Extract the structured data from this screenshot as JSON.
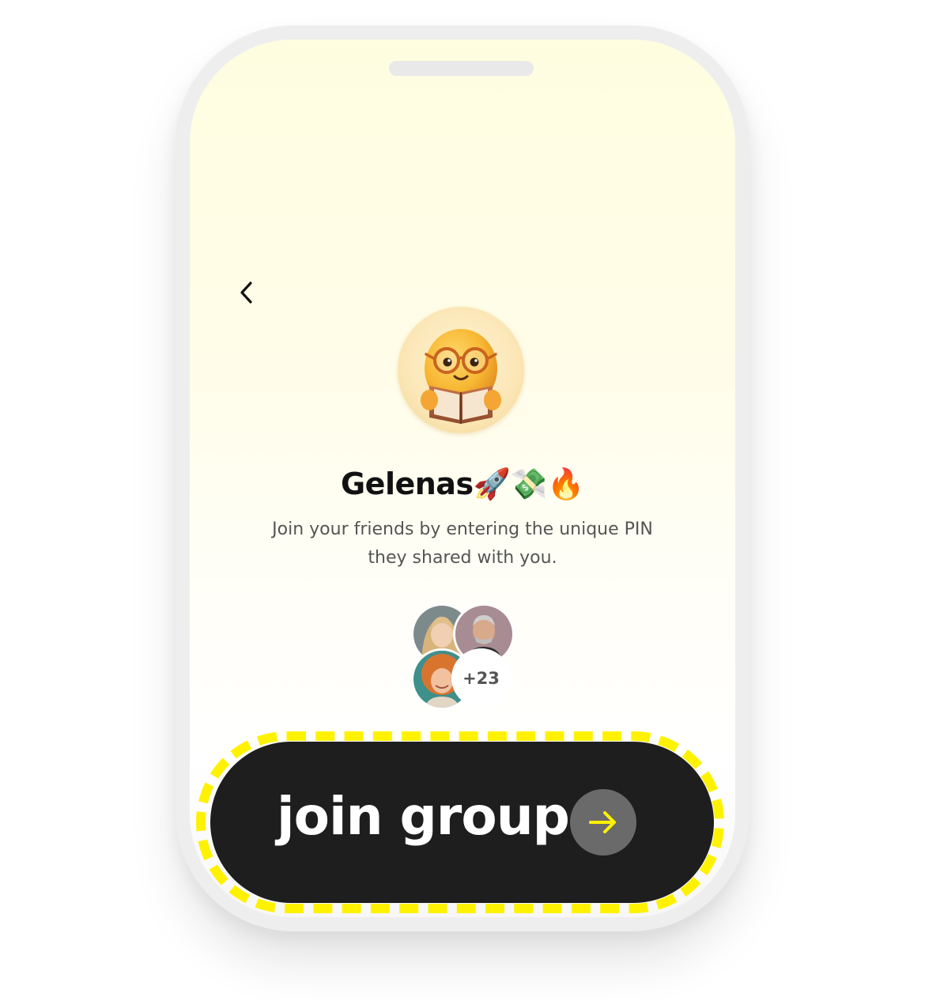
{
  "group": {
    "name": "Gelenas🚀💸🔥",
    "description": "Join your friends by entering the unique PIN they shared with you."
  },
  "members": {
    "extra_count": "+23"
  },
  "action": {
    "join_label": "join group"
  },
  "icons": {
    "back": "chevron-left-icon",
    "join_arrow": "arrow-right-icon",
    "group_avatar": "reading-emoji-avatar"
  },
  "colors": {
    "screen_top": "#fffde0",
    "button_bg": "#1e1e1e",
    "button_text": "#ffffff",
    "arrow_circle": "#6a6a6a",
    "arrow": "#fff200",
    "highlight_dash": "#fff200",
    "title_text": "#111111",
    "body_text": "#555555"
  }
}
